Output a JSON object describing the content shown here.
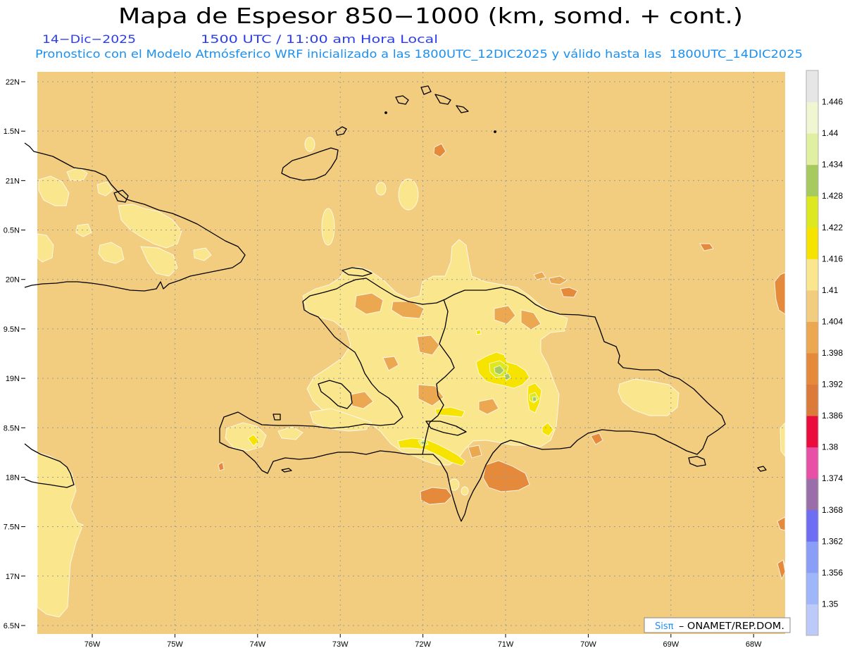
{
  "title": "Mapa de Espesor 850−1000 (km, somd. + cont.)",
  "subtitle": {
    "date": "14−Dic−2025",
    "time": "1500 UTC / 11:00 am Hora Local",
    "description": "Pronostico con el Modelo Atmósferico WRF inicializado a las 1800UTC_12DIC2025 y válido hasta las  1800UTC_14DIC2025"
  },
  "map": {
    "lat_labels": [
      "22N",
      "1.5N",
      "21N",
      "0.5N",
      "20N",
      "9.5N",
      "19N",
      "8.5N",
      "18N",
      "7.5N",
      "17N",
      "6.5N"
    ],
    "lon_labels": [
      "76W",
      "75W",
      "74W",
      "73W",
      "72W",
      "71W",
      "70W",
      "69W",
      "68W"
    ]
  },
  "colorbar": {
    "levels": [
      "1.35",
      "1.356",
      "1.362",
      "1.368",
      "1.374",
      "1.38",
      "1.386",
      "1.392",
      "1.398",
      "1.404",
      "1.41",
      "1.416",
      "1.422",
      "1.428",
      "1.434",
      "1.44",
      "1.446"
    ],
    "colors": [
      "#bccafa",
      "#9fb6fb",
      "#8a9ef8",
      "#6d6ef3",
      "#9a6ea8",
      "#e84fa6",
      "#ea0c3c",
      "#dc7a3a",
      "#e58a3a",
      "#eca850",
      "#f2cd80",
      "#fae68c",
      "#f6e400",
      "#dde81e",
      "#a6ca5e",
      "#e0f0a0",
      "#f0f5d2",
      "#e6e6e6"
    ]
  },
  "colors": {
    "date_text": "#2c3ee8",
    "description_text": "#1a90f0",
    "logo_text": "#1e90ff",
    "coastline": "#000000",
    "grid": "#9a9a9a"
  },
  "credit": {
    "logo": "Sisπ",
    "text": "– ONAMET/REP.DOM."
  }
}
